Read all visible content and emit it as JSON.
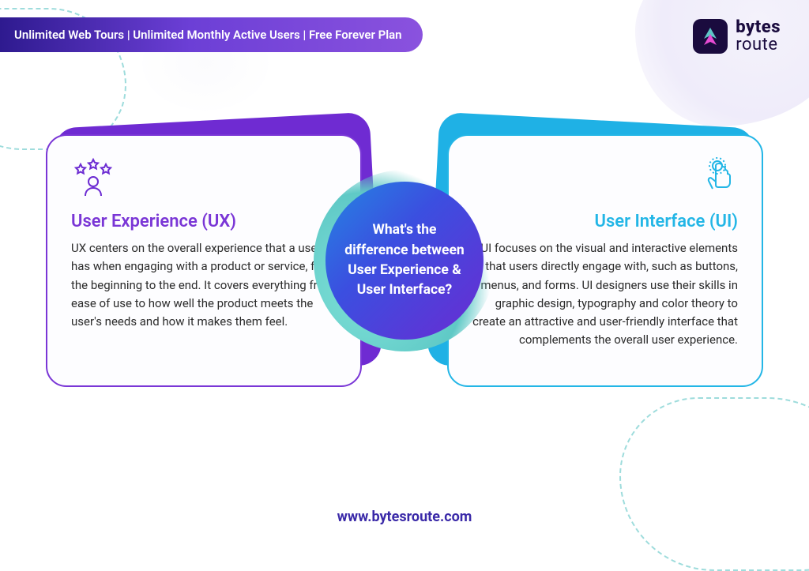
{
  "banner": {
    "text": "Unlimited Web Tours | Unlimited Monthly Active Users | Free Forever Plan"
  },
  "brand": {
    "line1": "bytes",
    "line2": "route"
  },
  "center": {
    "question": "What's the difference between User Experience & User Interface?"
  },
  "ux_card": {
    "title": "User Experience (UX)",
    "body": "UX centers on the overall experience that a user has when engaging with a product or service, from the beginning to the end. It covers everything from ease of use to how well the product meets the user's needs and how it makes them feel."
  },
  "ui_card": {
    "title": "User Interface (UI)",
    "body": "UI focuses on the visual and interactive elements that users directly engage with, such as buttons, menus, and forms. UI designers use their skills in graphic design, typography and color theory to create an attractive and user-friendly interface that complements the overall user experience."
  },
  "footer": {
    "url": "www.bytesroute.com"
  }
}
